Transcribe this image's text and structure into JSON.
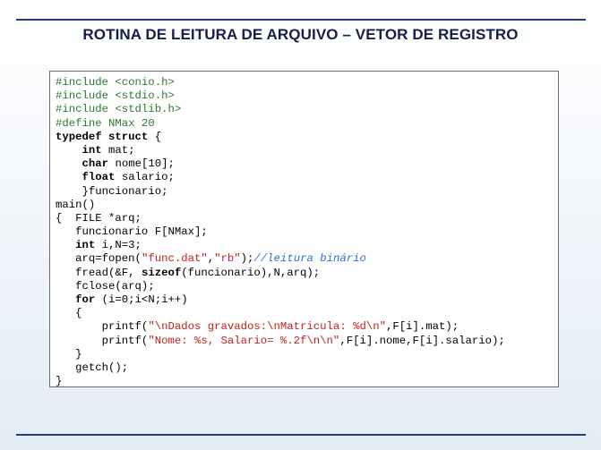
{
  "slide": {
    "title": "ROTINA DE LEITURA DE ARQUIVO – VETOR DE REGISTRO"
  },
  "colors": {
    "rule": "#1f3f7a",
    "title": "#14204a",
    "preprocessor": "#2b7a2b",
    "string": "#c0211d",
    "comment": "#2f6fd4"
  },
  "code": {
    "lines": [
      [
        {
          "t": "pp",
          "v": "#include <conio.h>"
        }
      ],
      [
        {
          "t": "pp",
          "v": "#include <stdio.h>"
        }
      ],
      [
        {
          "t": "pp",
          "v": "#include <stdlib.h>"
        }
      ],
      [
        {
          "t": "pp",
          "v": "#define NMax 20"
        }
      ],
      [
        {
          "t": "kw",
          "v": "typedef struct"
        },
        {
          "t": "n",
          "v": " {"
        }
      ],
      [
        {
          "t": "n",
          "v": "    "
        },
        {
          "t": "kw",
          "v": "int"
        },
        {
          "t": "n",
          "v": " mat;"
        }
      ],
      [
        {
          "t": "n",
          "v": "    "
        },
        {
          "t": "kw",
          "v": "char"
        },
        {
          "t": "n",
          "v": " nome[10];"
        }
      ],
      [
        {
          "t": "n",
          "v": "    "
        },
        {
          "t": "kw",
          "v": "float"
        },
        {
          "t": "n",
          "v": " salario;"
        }
      ],
      [
        {
          "t": "n",
          "v": "    }funcionario;"
        }
      ],
      [
        {
          "t": "n",
          "v": "main()"
        }
      ],
      [
        {
          "t": "n",
          "v": "{  FILE *arq;"
        }
      ],
      [
        {
          "t": "n",
          "v": "   funcionario F[NMax];"
        }
      ],
      [
        {
          "t": "n",
          "v": "   "
        },
        {
          "t": "kw",
          "v": "int"
        },
        {
          "t": "n",
          "v": " i,N=3;"
        }
      ],
      [
        {
          "t": "n",
          "v": "   arq=fopen("
        },
        {
          "t": "str",
          "v": "\"func.dat\""
        },
        {
          "t": "n",
          "v": ","
        },
        {
          "t": "str",
          "v": "\"rb\""
        },
        {
          "t": "n",
          "v": ");"
        },
        {
          "t": "cm",
          "v": "//leitura binário"
        }
      ],
      [
        {
          "t": "n",
          "v": "   fread(&F, "
        },
        {
          "t": "kw",
          "v": "sizeof"
        },
        {
          "t": "n",
          "v": "(funcionario),N,arq);"
        }
      ],
      [
        {
          "t": "n",
          "v": "   fclose(arq);"
        }
      ],
      [
        {
          "t": "n",
          "v": "   "
        },
        {
          "t": "kw",
          "v": "for"
        },
        {
          "t": "n",
          "v": " (i=0;i<N;i++)"
        }
      ],
      [
        {
          "t": "n",
          "v": "   {"
        }
      ],
      [
        {
          "t": "n",
          "v": "       printf("
        },
        {
          "t": "str",
          "v": "\"\\nDados gravados:\\nMatricula: %d\\n\""
        },
        {
          "t": "n",
          "v": ",F[i].mat);"
        }
      ],
      [
        {
          "t": "n",
          "v": "       printf("
        },
        {
          "t": "str",
          "v": "\"Nome: %s, Salario= %.2f\\n\\n\""
        },
        {
          "t": "n",
          "v": ",F[i].nome,F[i].salario);"
        }
      ],
      [
        {
          "t": "n",
          "v": "   }"
        }
      ],
      [
        {
          "t": "n",
          "v": "   getch();"
        }
      ],
      [
        {
          "t": "n",
          "v": "}"
        }
      ]
    ]
  }
}
